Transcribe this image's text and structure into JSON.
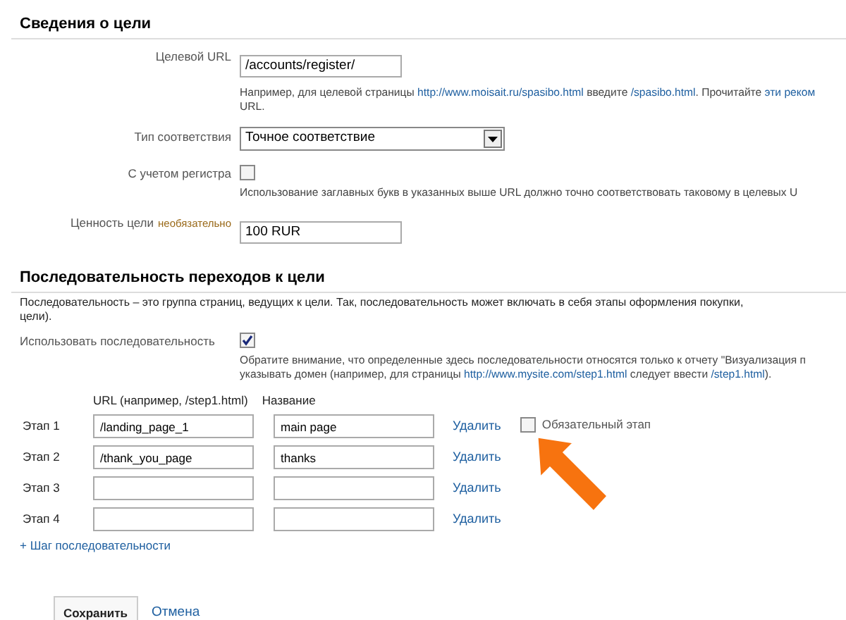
{
  "goal_details": {
    "title": "Сведения о цели",
    "fields": [
      {
        "kind": "text",
        "label": "Целевой URL",
        "value": "/accounts/register/",
        "hint_lines": [
          [
            {
              "kind": "text",
              "text": "Например, для целевой страницы "
            },
            {
              "kind": "link",
              "text": "http://www.moisait.ru/spasibo.html"
            },
            {
              "kind": "text",
              "text": " введите "
            },
            {
              "kind": "link",
              "text": "/spasibo.html"
            },
            {
              "kind": "text",
              "text": ". Прочитайте "
            },
            {
              "kind": "link",
              "text": "эти реком"
            }
          ],
          [
            {
              "kind": "text",
              "text": "URL."
            }
          ]
        ]
      },
      {
        "kind": "select",
        "label": "Тип соответствия",
        "value": "Точное соответствие"
      },
      {
        "kind": "checkbox",
        "label": "С учетом регистра",
        "checked": false,
        "hint_lines": [
          [
            {
              "kind": "text",
              "text": "Использование заглавных букв в указанных выше URL должно точно соответствовать таковому в целевых U"
            }
          ]
        ]
      },
      {
        "kind": "text",
        "label": "Ценность цели",
        "note": "необязательно",
        "value": "100 RUR"
      }
    ]
  },
  "funnel": {
    "title": "Последовательность переходов к цели",
    "description_lines": [
      "Последовательность – это группа страниц, ведущих к цели. Так, последовательность может включать в себя этапы оформления покупки,",
      "цели)."
    ],
    "use_funnel": {
      "label": "Использовать последовательность",
      "checked": true,
      "hint_lines": [
        [
          {
            "kind": "text",
            "text": "Обратите внимание, что определенные здесь последовательности относятся только к отчету \"Визуализация п"
          }
        ],
        [
          {
            "kind": "text",
            "text": "указывать домен (например, для страницы "
          },
          {
            "kind": "link",
            "text": "http://www.mysite.com/step1.html"
          },
          {
            "kind": "text",
            "text": " следует ввести "
          },
          {
            "kind": "link",
            "text": "/step1.html"
          },
          {
            "kind": "text",
            "text": ")."
          }
        ]
      ]
    },
    "columns": [
      "URL (например, /step1.html)",
      "Название"
    ],
    "steps": [
      {
        "label": "Этап 1",
        "url": "/landing_page_1",
        "name": "main page",
        "delete": "Удалить",
        "required": {
          "label": "Обязательный этап",
          "checked": false
        }
      },
      {
        "label": "Этап 2",
        "url": "/thank_you_page",
        "name": "thanks",
        "delete": "Удалить"
      },
      {
        "label": "Этап 3",
        "delete": "Удалить"
      },
      {
        "label": "Этап 4",
        "delete": "Удалить"
      }
    ],
    "add_step": "+ Шаг последовательности"
  },
  "buttons": {
    "save": "Сохранить",
    "cancel": "Отмена"
  }
}
